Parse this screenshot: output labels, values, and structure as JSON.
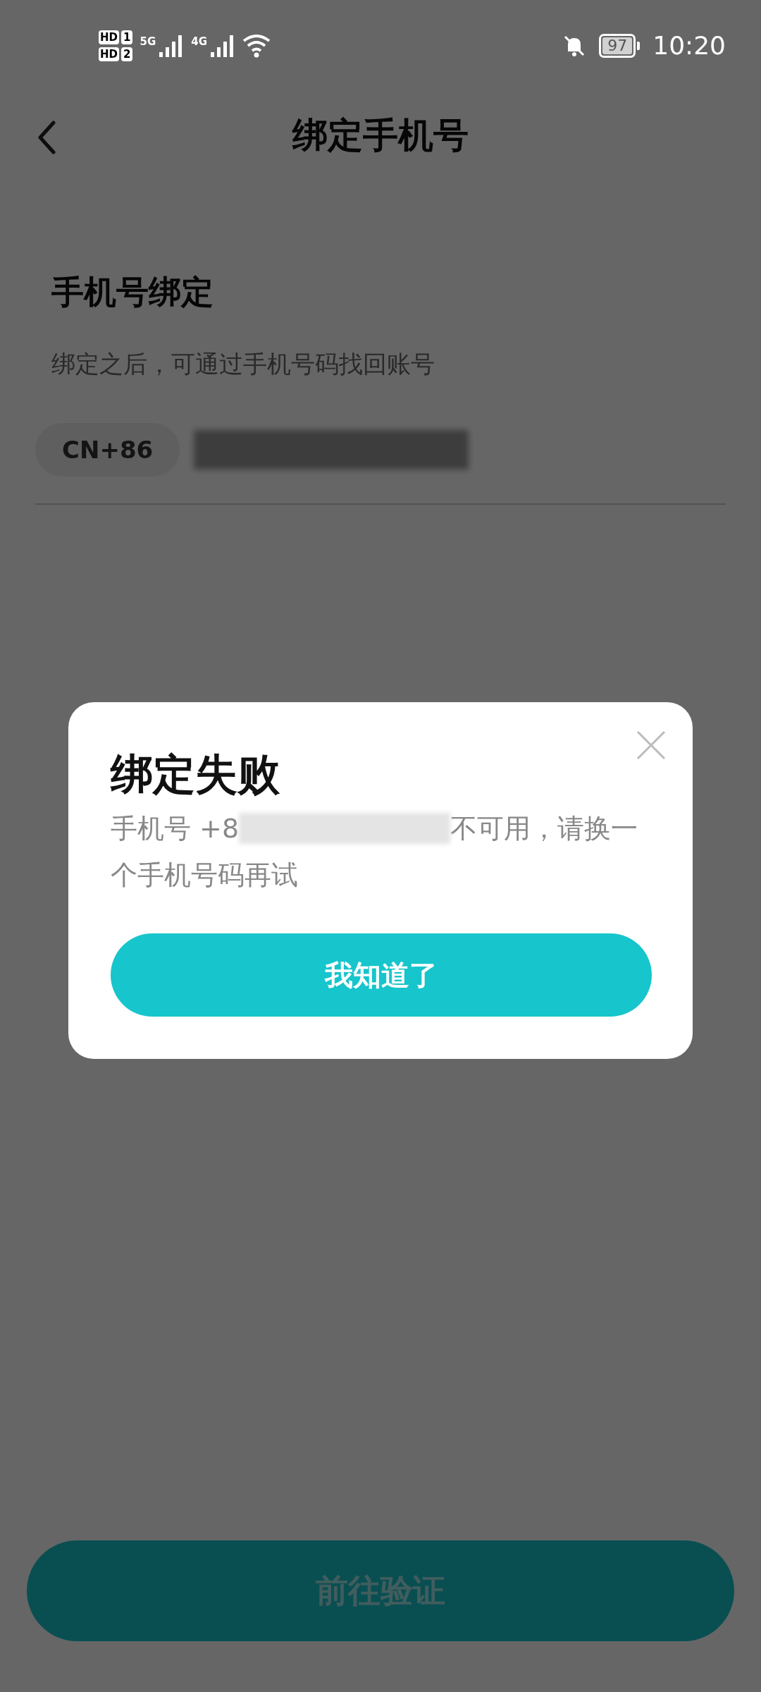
{
  "status_bar": {
    "sim_labels": [
      "HD",
      "HD"
    ],
    "sim_numbers": [
      "1",
      "2"
    ],
    "network_types": [
      "5G",
      "4G"
    ],
    "battery": "97",
    "time": "10:20"
  },
  "header": {
    "title": "绑定手机号"
  },
  "section": {
    "heading": "手机号绑定",
    "description": "绑定之后，可通过手机号码找回账号"
  },
  "phone_field": {
    "country_code": "CN+86",
    "redacted": true
  },
  "primary_button": {
    "label": "前往验证"
  },
  "dialog": {
    "title": "绑定失败",
    "message_start": "手机号 +8",
    "message_redacted": true,
    "message_middle": "不可用，请换一",
    "message_end": "个手机号码再试",
    "button": "我知道了"
  }
}
